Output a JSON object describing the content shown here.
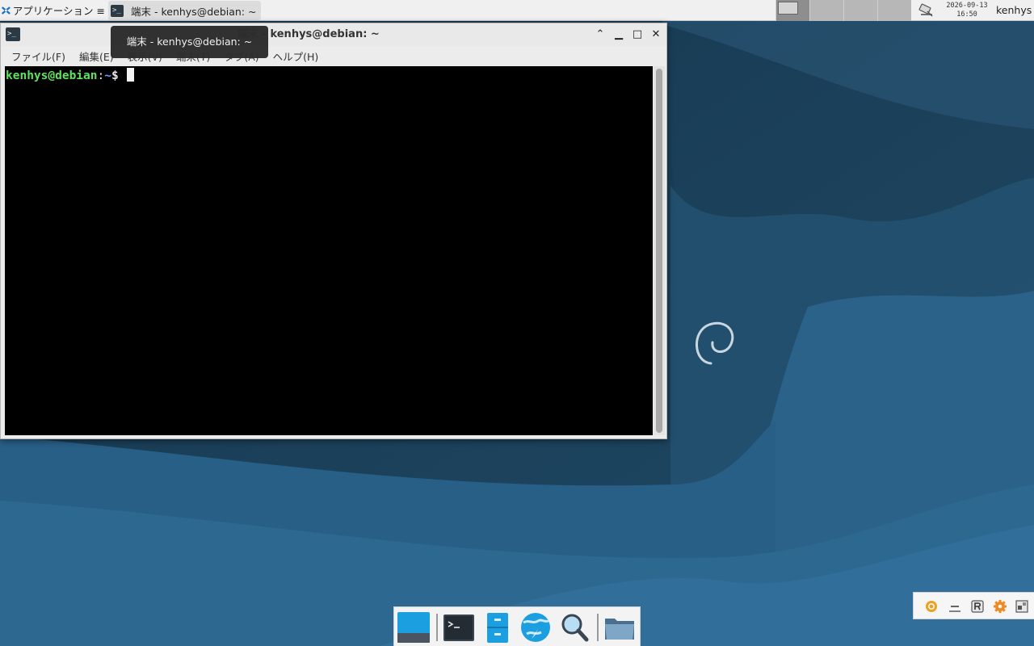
{
  "top_panel": {
    "apps_menu_label": "アプリケーション ≡",
    "task_title": "端末  -  kenhys@debian: ~",
    "clock_date": "2026-09-13",
    "clock_time": "16:50",
    "user": "kenhys"
  },
  "terminal": {
    "title": "端末  -  kenhys@debian: ~",
    "menu": [
      "ファイル(F)",
      "編集(E)",
      "表示(V)",
      "端末(T)",
      "タブ(A)",
      "ヘルプ(H)"
    ],
    "prompt_user": "kenhys@debian",
    "prompt_sep": ":",
    "prompt_path": "~",
    "prompt_symbol": "$ "
  },
  "tooltip": "端末  -  kenhys@debian: ~",
  "dock": {
    "items": [
      "show-desktop-icon",
      "terminal-icon",
      "file-manager-icon",
      "web-browser-icon",
      "app-finder-icon",
      "home-folder-icon"
    ]
  },
  "tray": {
    "icons": [
      "ubuntu-orange-icon",
      "minimize-all-icon",
      "r-letter-icon",
      "settings-gear-icon",
      "workspace-switch-icon"
    ]
  },
  "colors": {
    "prompt_user": "#5ee35e",
    "prompt_path": "#6d9cff",
    "terminal_bg": "#000000",
    "accent_blue": "#1c9fe0"
  }
}
